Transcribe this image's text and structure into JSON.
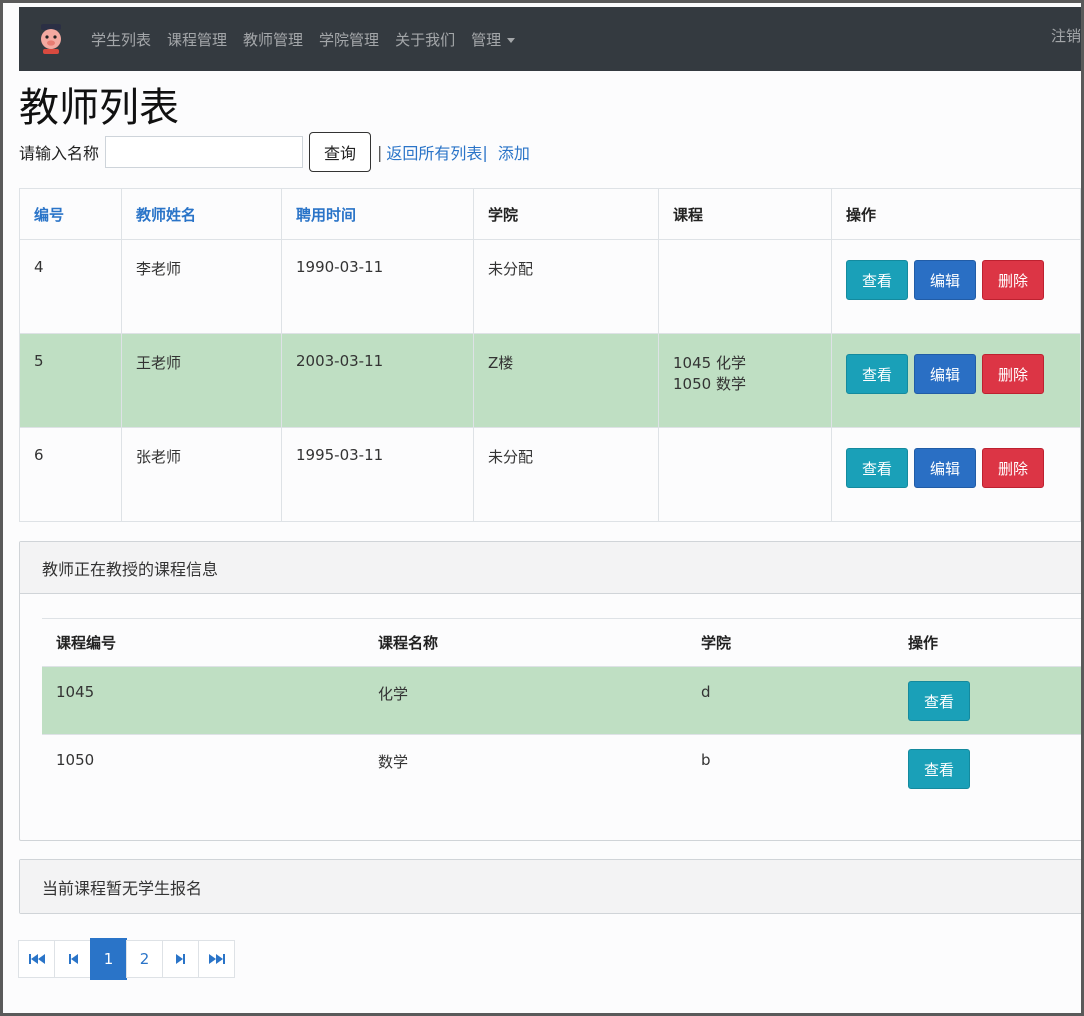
{
  "navbar": {
    "logo_icon": "pig-mascot-icon",
    "items": [
      "学生列表",
      "课程管理",
      "教师管理",
      "学院管理",
      "关于我们",
      "管理"
    ],
    "right_link": "注销"
  },
  "page_title": "教师列表",
  "search": {
    "label": "请输入名称",
    "value": "",
    "placeholder": "",
    "button": "查询",
    "sep1": "|",
    "return_link": "返回所有列表",
    "sep2": "|",
    "add_link": "添加"
  },
  "teacher_table": {
    "headers": [
      "编号",
      "教师姓名",
      "聘用时间",
      "学院",
      "课程",
      "操作"
    ],
    "rows": [
      {
        "id": "4",
        "name": "李老师",
        "hire_date": "1990-03-11",
        "college": "未分配",
        "courses": [
          "",
          ""
        ],
        "highlight": false
      },
      {
        "id": "5",
        "name": "王老师",
        "hire_date": "2003-03-11",
        "college": "Z楼",
        "courses": [
          "1045 化学",
          "1050 数学"
        ],
        "highlight": true
      },
      {
        "id": "6",
        "name": "张老师",
        "hire_date": "1995-03-11",
        "college": "未分配",
        "courses": [
          "",
          ""
        ],
        "highlight": false
      }
    ],
    "actions": {
      "view": "查看",
      "edit": "编辑",
      "delete": "删除"
    }
  },
  "courses_card": {
    "title": "教师正在教授的课程信息",
    "headers": [
      "课程编号",
      "课程名称",
      "学院",
      "操作"
    ],
    "rows": [
      {
        "code": "1045",
        "name": "化学",
        "college": "d",
        "highlight": true
      },
      {
        "code": "1050",
        "name": "数学",
        "college": "b",
        "highlight": false
      }
    ],
    "view_label": "查看"
  },
  "students_card": {
    "title": "当前课程暂无学生报名"
  },
  "pagination": {
    "pages": [
      "1",
      "2"
    ],
    "current": "1"
  },
  "colors": {
    "navbar": "#343a40",
    "link": "#2a74c8",
    "highlight_row": "#bfdfc3",
    "btn_info": "#1aa0b8",
    "btn_primary": "#2a6fc4",
    "btn_danger": "#dc3545"
  }
}
